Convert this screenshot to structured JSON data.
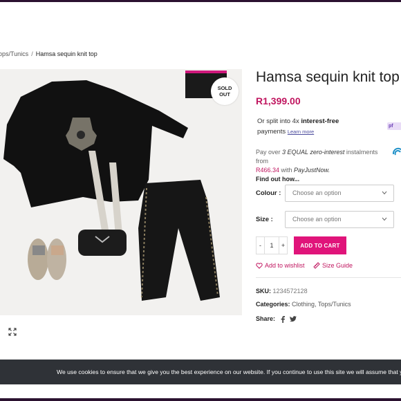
{
  "breadcrumb": {
    "parent": "ops/Tunics",
    "separator": "/",
    "current": "Hamsa sequin knit top"
  },
  "product": {
    "title": "Hamsa sequin knit top",
    "price": "R1,399.00",
    "badge_line1": "SOLD",
    "badge_line2": "OUT"
  },
  "payflex": {
    "text_pre": "Or split into 4x ",
    "text_bold": "interest-free",
    "text_post": "payments",
    "link": "Learn more",
    "logo": "pf"
  },
  "payjustnow": {
    "line1_pre": "Pay over ",
    "line1_italic": "3 EQUAL zero-interest",
    "line1_post": " instalments from",
    "amount": "R466.34",
    "with": " with ",
    "brand": "PayJustNow.",
    "find": "Find out how..."
  },
  "options": {
    "colour_label": "Colour",
    "colour_placeholder": "Choose an option",
    "size_label": "Size",
    "size_placeholder": "Choose an option"
  },
  "cart": {
    "minus": "-",
    "qty": "1",
    "plus": "+",
    "button": "ADD TO CART"
  },
  "links": {
    "wishlist": "Add to wishlist",
    "size_guide": "Size Guide"
  },
  "meta": {
    "sku_label": "SKU:",
    "sku_value": "1234572128",
    "categories_label": "Categories:",
    "category1": "Clothing",
    "category2": "Tops/Tunics",
    "share_label": "Share:"
  },
  "cookie": {
    "text": "We use cookies to ensure that we give you the best experience on our website. If you continue to use this site we will assume that you are happy with it."
  },
  "colors": {
    "accent": "#c0155f",
    "button": "#e0147a",
    "cookie_bg": "#2f3237"
  }
}
